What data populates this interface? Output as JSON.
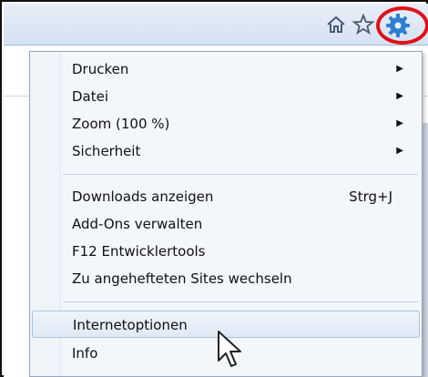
{
  "toolbar": {
    "icons": [
      "home-icon",
      "star-icon",
      "gear-icon"
    ],
    "highlight_color": "#e0101a",
    "gear_color": "#2c7fd1"
  },
  "menu": {
    "items": [
      {
        "label": "Drucken",
        "submenu": true
      },
      {
        "label": "Datei",
        "submenu": true
      },
      {
        "label": "Zoom (100 %)",
        "submenu": true
      },
      {
        "label": "Sicherheit",
        "submenu": true
      },
      {
        "label": "Downloads anzeigen",
        "shortcut": "Strg+J"
      },
      {
        "label": "Add-Ons verwalten"
      },
      {
        "label": "F12 Entwicklertools"
      },
      {
        "label": "Zu angehefteten Sites wechseln"
      },
      {
        "label": "Internetoptionen",
        "hovered": true
      },
      {
        "label": "Info"
      }
    ]
  },
  "arrow_glyph": "▶"
}
